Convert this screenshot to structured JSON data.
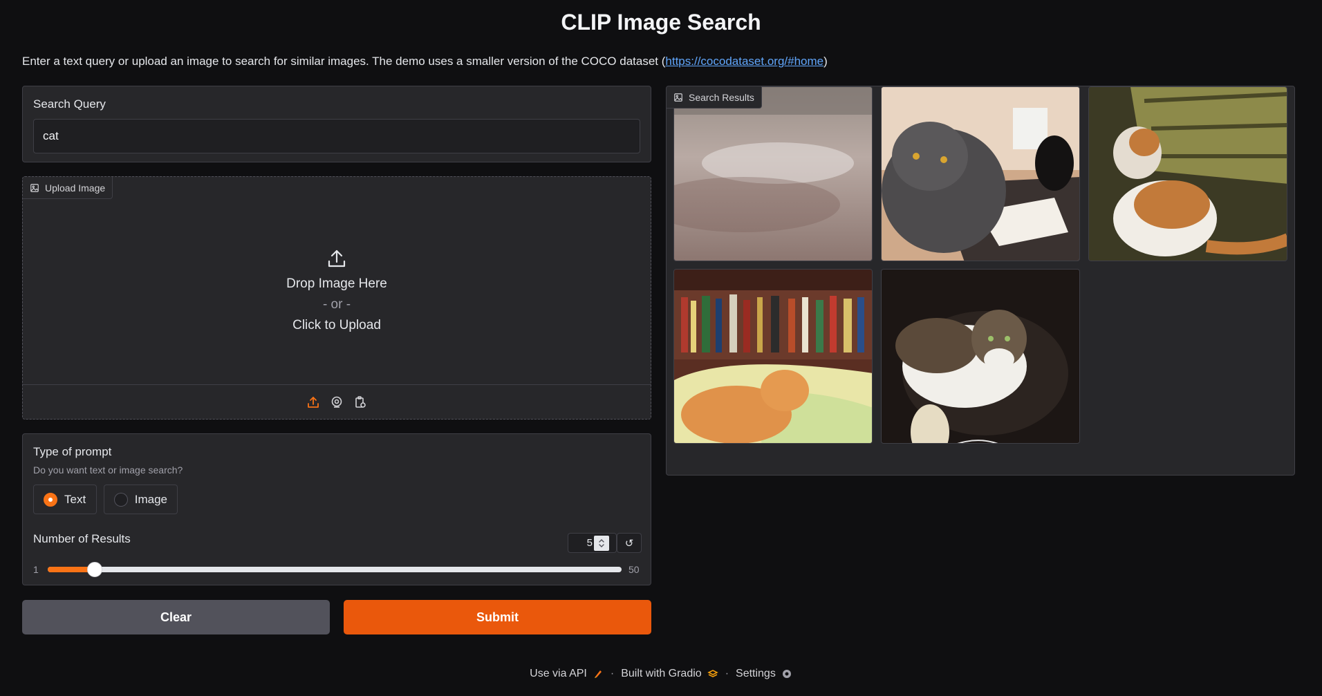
{
  "header": {
    "title": "CLIP Image Search",
    "description": "Enter a text query or upload an image to search for similar images. The demo uses a smaller version of the COCO dataset (",
    "link_text": "https://cocodataset.org/#home",
    "description_end": ")"
  },
  "query": {
    "label": "Search Query",
    "value": "cat"
  },
  "upload": {
    "label": "Upload Image",
    "drop_text": "Drop Image Here",
    "or_text": "- or -",
    "click_text": "Click to Upload"
  },
  "prompt_type": {
    "label": "Type of prompt",
    "info": "Do you want text or image search?",
    "options": [
      "Text",
      "Image"
    ],
    "selected": "Text"
  },
  "num_results": {
    "label": "Number of Results",
    "value": "5",
    "min": "1",
    "max": "50",
    "fraction": 0.0816
  },
  "buttons": {
    "clear": "Clear",
    "submit": "Submit"
  },
  "gallery": {
    "label": "Search Results",
    "items": [
      "close-up fur",
      "grey cat on desk",
      "orange white cat",
      "orange kitten on bed",
      "tabby white cat with mouse"
    ]
  },
  "footer": {
    "api": "Use via API",
    "built": "Built with Gradio",
    "settings": "Settings"
  },
  "colors": {
    "accent": "#f97316",
    "submit": "#ea580c",
    "background": "#0f0f11",
    "panel": "#27272a"
  }
}
